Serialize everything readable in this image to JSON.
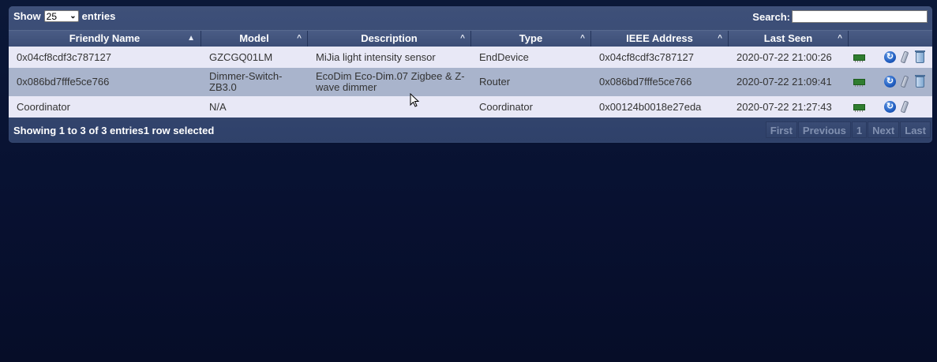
{
  "controls": {
    "show_label": "Show",
    "page_size_value": "25",
    "entries_label": "entries",
    "search_label": "Search:",
    "search_value": ""
  },
  "table": {
    "columns": [
      "Friendly Name",
      "Model",
      "Description",
      "Type",
      "IEEE Address",
      "Last Seen"
    ],
    "rows": [
      {
        "friendly_name": "0x04cf8cdf3c787127",
        "model": "GZCGQ01LM",
        "description": "MiJia light intensity sensor",
        "type": "EndDevice",
        "ieee": "0x04cf8cdf3c787127",
        "last_seen": "2020-07-22 21:00:26"
      },
      {
        "friendly_name": "0x086bd7fffe5ce766",
        "model": "Dimmer-Switch-ZB3.0",
        "description": "EcoDim Eco-Dim.07 Zigbee & Z-wave dimmer",
        "type": "Router",
        "ieee": "0x086bd7fffe5ce766",
        "last_seen": "2020-07-22 21:09:41"
      },
      {
        "friendly_name": "Coordinator",
        "model": "N/A",
        "description": "",
        "type": "Coordinator",
        "ieee": "0x00124b0018e27eda",
        "last_seen": "2020-07-22 21:27:43"
      }
    ]
  },
  "footer": {
    "info": "Showing 1 to 3 of 3 entries1 row selected"
  },
  "pagination": {
    "first": "First",
    "previous": "Previous",
    "page": "1",
    "next": "Next",
    "last": "Last"
  },
  "icons": {
    "device": "device-board-icon",
    "refresh": "refresh-icon",
    "rename": "edit-pencil-icon",
    "delete": "trash-icon"
  }
}
